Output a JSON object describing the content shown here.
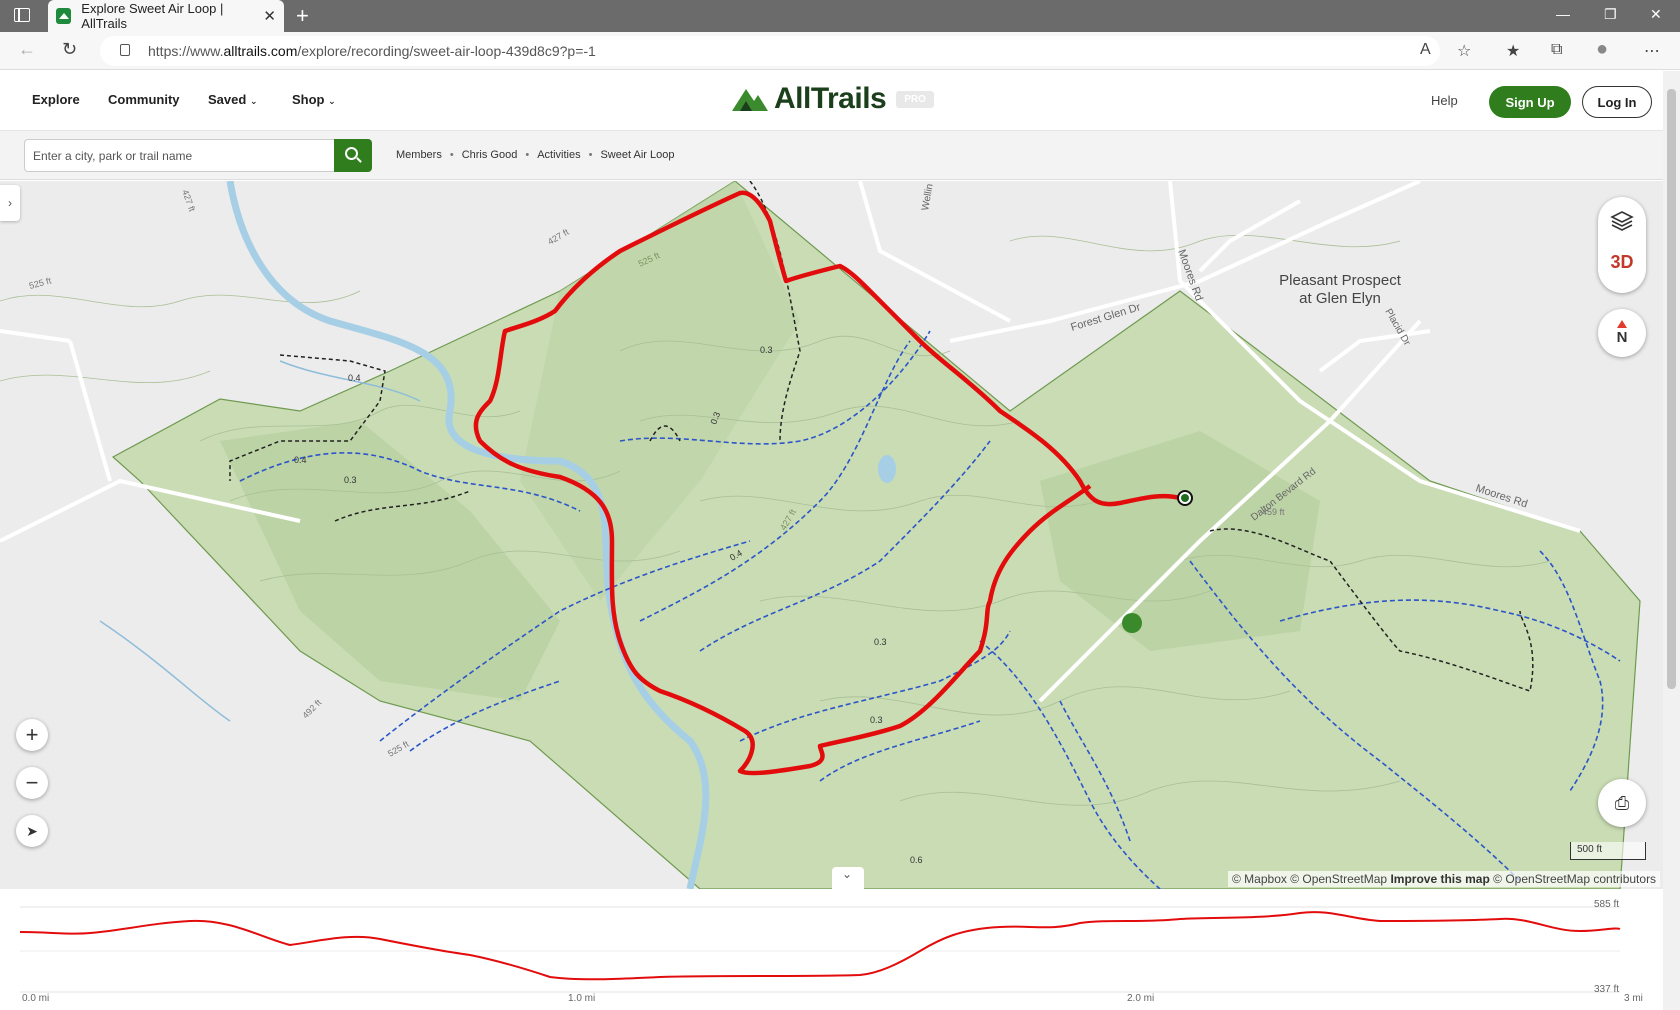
{
  "browser": {
    "tab_title": "Explore Sweet Air Loop | AllTrails",
    "url_prefix": "https://www.",
    "url_host": "alltrails.com",
    "url_path": "/explore/recording/sweet-air-loop-439d8c9?p=-1"
  },
  "header": {
    "nav": [
      "Explore",
      "Community",
      "Saved",
      "Shop"
    ],
    "logo_text": "AllTrails",
    "pro_badge": "PRO",
    "help": "Help",
    "signup": "Sign Up",
    "login": "Log In"
  },
  "search": {
    "placeholder": "Enter a city, park or trail name"
  },
  "breadcrumb": [
    "Members",
    "Chris Good",
    "Activities",
    "Sweet Air Loop"
  ],
  "map": {
    "place_label_1": "Pleasant Prospect",
    "place_label_2": "at Glen Elyn",
    "road_labels": [
      "Forest Glen Dr",
      "Moores Rd",
      "Dalton Bevard Rd",
      "Moores Rd",
      "Placid Dr",
      "Wellin"
    ],
    "contour_labels": [
      "525 ft",
      "427 ft",
      "427 ft",
      "492 ft",
      "525 ft",
      "525 ft",
      "459 ft",
      "427 ft"
    ],
    "segment_labels": [
      "0.4",
      "0.4",
      "0.3",
      "0.3",
      "0.3",
      "0.4",
      "0.3",
      "0.3",
      "0.6"
    ],
    "control_3d": "3D",
    "compass": "N",
    "scale": "500 ft",
    "attribution_1": "© Mapbox © OpenStreetMap",
    "attribution_link": "Improve this map",
    "attribution_2": "© OpenStreetMap contributors",
    "colors": {
      "park": "#c9dcb4",
      "route": "#e30c0c",
      "trail_blue": "#2b55c9"
    }
  },
  "elevation": {
    "max_label": "585 ft",
    "min_label": "337 ft",
    "x_labels": [
      "0.0 mi",
      "1.0 mi",
      "2.0 mi",
      "3 mi"
    ]
  }
}
